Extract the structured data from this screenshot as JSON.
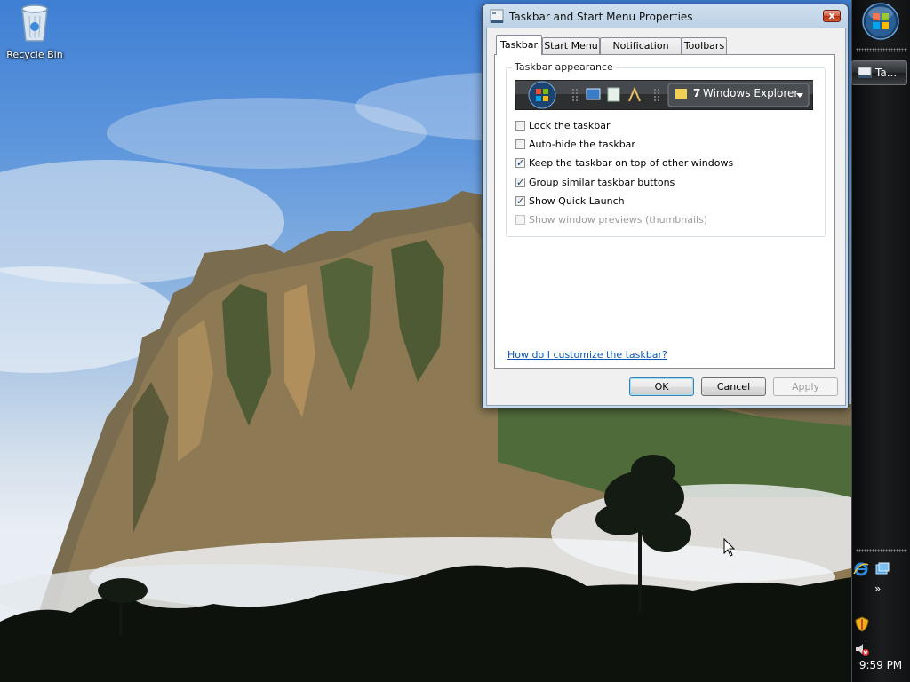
{
  "desktop": {
    "recycle_bin_label": "Recycle Bin"
  },
  "taskbar": {
    "running_task_label": "Ta...",
    "clock": "9:59 PM",
    "chevron": "»"
  },
  "dialog": {
    "title": "Taskbar and Start Menu Properties",
    "close_glyph": "x",
    "tabs": [
      {
        "label": "Taskbar",
        "active": true
      },
      {
        "label": "Start Menu",
        "active": false
      },
      {
        "label": "Notification Area",
        "active": false
      },
      {
        "label": "Toolbars",
        "active": false
      }
    ],
    "group_label": "Taskbar appearance",
    "preview": {
      "window_count": "7",
      "window_label": "Windows Explorer"
    },
    "options": [
      {
        "label": "Lock the taskbar",
        "checked": false,
        "enabled": true
      },
      {
        "label": "Auto-hide the taskbar",
        "checked": false,
        "enabled": true
      },
      {
        "label": "Keep the taskbar on top of other windows",
        "checked": true,
        "enabled": true
      },
      {
        "label": "Group similar taskbar buttons",
        "checked": true,
        "enabled": true
      },
      {
        "label": "Show Quick Launch",
        "checked": true,
        "enabled": true
      },
      {
        "label": "Show window previews (thumbnails)",
        "checked": false,
        "enabled": false
      }
    ],
    "help_link": "How do I customize the taskbar?",
    "buttons": {
      "ok": "OK",
      "cancel": "Cancel",
      "apply": "Apply"
    }
  },
  "colors": {
    "taskbar_bg": "#141618",
    "link": "#0b57b8",
    "close_button": "#c94a2c"
  }
}
